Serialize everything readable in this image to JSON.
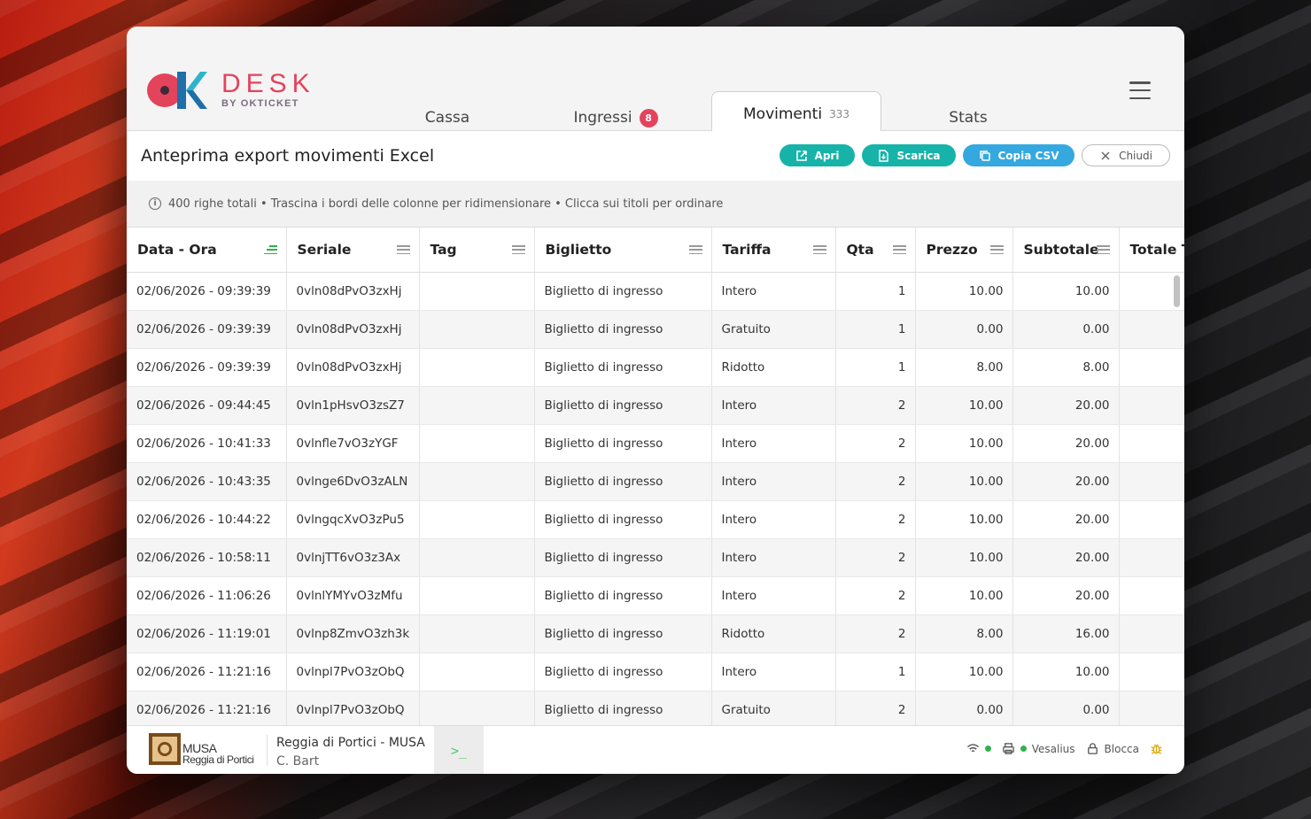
{
  "header": {
    "logo_title": "DESK",
    "logo_sub": "BY OKTICKET",
    "tabs": [
      {
        "label": "Cassa"
      },
      {
        "label": "Ingressi",
        "badge": "8"
      },
      {
        "label": "Movimenti",
        "count": "333"
      },
      {
        "label": "Stats"
      }
    ]
  },
  "toolbar": {
    "title": "Anteprima export movimenti Excel",
    "apri_label": "Apri",
    "scarica_label": "Scarica",
    "copia_label": "Copia CSV",
    "chiudi_label": "Chiudi"
  },
  "info": {
    "text": "400 righe totali • Trascina i bordi delle colonne per ridimensionare • Clicca sui titoli per ordinare"
  },
  "table": {
    "columns": [
      "Data - Ora",
      "Seriale",
      "Tag",
      "Biglietto",
      "Tariffa",
      "Qta",
      "Prezzo",
      "Subtotale",
      "Totale T"
    ],
    "rows": [
      [
        "02/06/2026 - 09:39:39",
        "0vln08dPvO3zxHj",
        "",
        "Biglietto di ingresso",
        "Intero",
        "1",
        "10.00",
        "10.00",
        ""
      ],
      [
        "02/06/2026 - 09:39:39",
        "0vln08dPvO3zxHj",
        "",
        "Biglietto di ingresso",
        "Gratuito",
        "1",
        "0.00",
        "0.00",
        ""
      ],
      [
        "02/06/2026 - 09:39:39",
        "0vln08dPvO3zxHj",
        "",
        "Biglietto di ingresso",
        "Ridotto",
        "1",
        "8.00",
        "8.00",
        ""
      ],
      [
        "02/06/2026 - 09:44:45",
        "0vln1pHsvO3zsZ7",
        "",
        "Biglietto di ingresso",
        "Intero",
        "2",
        "10.00",
        "20.00",
        ""
      ],
      [
        "02/06/2026 - 10:41:33",
        "0vlnfle7vO3zYGF",
        "",
        "Biglietto di ingresso",
        "Intero",
        "2",
        "10.00",
        "20.00",
        ""
      ],
      [
        "02/06/2026 - 10:43:35",
        "0vlnge6DvO3zALN",
        "",
        "Biglietto di ingresso",
        "Intero",
        "2",
        "10.00",
        "20.00",
        ""
      ],
      [
        "02/06/2026 - 10:44:22",
        "0vlngqcXvO3zPu5",
        "",
        "Biglietto di ingresso",
        "Intero",
        "2",
        "10.00",
        "20.00",
        ""
      ],
      [
        "02/06/2026 - 10:58:11",
        "0vlnjTT6vO3z3Ax",
        "",
        "Biglietto di ingresso",
        "Intero",
        "2",
        "10.00",
        "20.00",
        ""
      ],
      [
        "02/06/2026 - 11:06:26",
        "0vlnlYMYvO3zMfu",
        "",
        "Biglietto di ingresso",
        "Intero",
        "2",
        "10.00",
        "20.00",
        ""
      ],
      [
        "02/06/2026 - 11:19:01",
        "0vlnp8ZmvO3zh3k",
        "",
        "Biglietto di ingresso",
        "Ridotto",
        "2",
        "8.00",
        "16.00",
        ""
      ],
      [
        "02/06/2026 - 11:21:16",
        "0vlnpl7PvO3zObQ",
        "",
        "Biglietto di ingresso",
        "Intero",
        "1",
        "10.00",
        "10.00",
        ""
      ],
      [
        "02/06/2026 - 11:21:16",
        "0vlnpl7PvO3zObQ",
        "",
        "Biglietto di ingresso",
        "Gratuito",
        "2",
        "0.00",
        "0.00",
        ""
      ]
    ]
  },
  "footer": {
    "org_name": "MUSA",
    "org_sub": "Reggia di Portici",
    "venue": "Reggia di Portici - MUSA",
    "user": "C. Bart",
    "terminal_icon": "terminal-icon",
    "printer_name": "Vesalius",
    "lock_label": "Blocca"
  },
  "colors": {
    "brand": "#e4435c",
    "teal": "#17b3a8",
    "blue": "#35a8e0",
    "status_ok": "#2fb34a"
  }
}
